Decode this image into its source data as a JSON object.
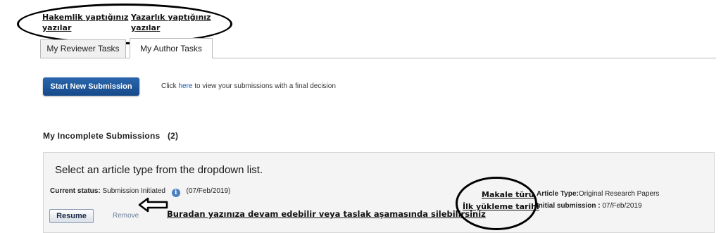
{
  "annotations": {
    "reviewer_note": "Hakemlik yaptığınız yazılar",
    "author_note": "Yazarlık yaptığınız yazılar",
    "article_type_note": "Makale türü",
    "initial_upload_note": "İlk yükleme tarihi",
    "resume_note": "Buradan yazınıza devam edebilir veya taslak aşamasında silebilirsiniz",
    "reviewer_note_lines": [
      "Hakemlik yaptığınız",
      "yazılar"
    ],
    "author_note_lines": [
      "Yazarlık yaptığınız",
      "yazılar"
    ]
  },
  "tabs": [
    {
      "label": "My Reviewer Tasks",
      "active": false
    },
    {
      "label": "My Author Tasks",
      "active": true
    }
  ],
  "actions": {
    "start_new_submission": "Start New Submission",
    "info_prefix": "Click",
    "info_link": "here",
    "info_suffix": "to view your submissions with a final decision"
  },
  "incomplete": {
    "title": "My Incomplete Submissions",
    "count": "(2)"
  },
  "submission": {
    "title": "Select an article type from the dropdown list.",
    "status_label": "Current status:",
    "status_value": "Submission Initiated",
    "status_date": "(07/Feb/2019)",
    "article_type_label": "Article Type:",
    "article_type_value": "Original Research Papers",
    "initial_submission_label": "Initial submission :",
    "initial_submission_value": "07/Feb/2019",
    "resume_label": "Resume",
    "remove_label": "Remove"
  },
  "icons": {
    "info": "info-icon",
    "arrow": "left-arrow-icon"
  },
  "colors": {
    "primary_button": "#1f5a9e",
    "link": "#1a5aa6",
    "card_background": "#f4f4f4"
  }
}
